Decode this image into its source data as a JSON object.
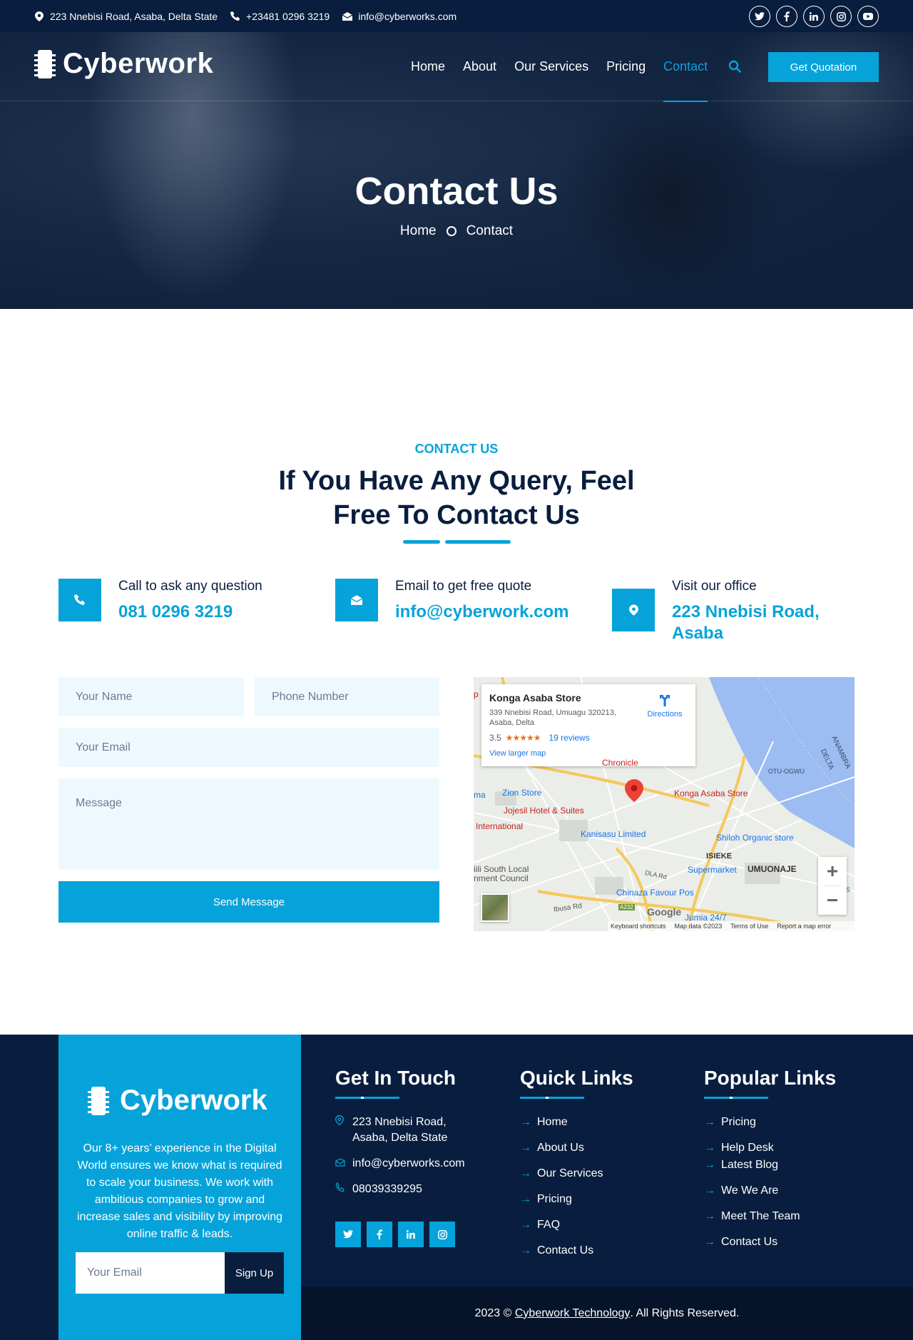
{
  "topbar": {
    "address": "223 Nnebisi Road, Asaba, Delta State",
    "phone": "+23481 0296 3219",
    "email": "info@cyberworks.com",
    "social": [
      "twitter-icon",
      "facebook-icon",
      "linkedin-icon",
      "instagram-icon",
      "youtube-icon"
    ]
  },
  "nav": {
    "brand": "Cyberwork",
    "items": [
      "Home",
      "About",
      "Our Services",
      "Pricing",
      "Contact"
    ],
    "active_item": "Contact",
    "quote_button": "Get Quotation"
  },
  "hero": {
    "title": "Contact Us",
    "breadcrumb": [
      "Home",
      "Contact"
    ]
  },
  "contact": {
    "label": "CONTACT US",
    "title_line1": "If You Have Any Query, Feel",
    "title_line2": "Free To Contact Us",
    "cards": [
      {
        "icon": "phone-icon",
        "label": "Call to ask any question",
        "value": "081 0296 3219"
      },
      {
        "icon": "envelope-icon",
        "label": "Email to get free quote",
        "value": "info@cyberwork.com"
      },
      {
        "icon": "location-pin-icon",
        "label": "Visit our office",
        "value_line1": "223 Nnebisi Road,",
        "value_line2": "Asaba"
      }
    ]
  },
  "form": {
    "name_placeholder": "Your Name",
    "phone_placeholder": "Phone Number",
    "email_placeholder": "Your Email",
    "message_placeholder": "Message",
    "submit_label": "Send Message"
  },
  "map": {
    "place_title": "Konga Asaba Store",
    "place_address": "339 Nnebisi Road, Umuagu 320213, Asaba, Delta",
    "rating": "3.5",
    "stars": "★★★★★",
    "reviews": "19 reviews",
    "view_larger": "View larger map",
    "directions": "Directions",
    "labels": {
      "chronicle": "Chronicle",
      "zion": "Zion Store",
      "ma": "ma",
      "jojesil": "Jojesil Hotel & Suites",
      "international": "International",
      "kanisasu": "Kanisasu Limited",
      "konga": "Konga Asaba Store",
      "shiloh": "Shiloh Organic store",
      "otu_ogwu": "OTU-OGWU",
      "anambra": "ANAMBRA",
      "delta": "DELTA",
      "isieke": "ISIEKE",
      "umuonaje": "UMUONAJE",
      "supermarket": "Supermarket",
      "south_local": "iili South Local",
      "council": "nment Council",
      "dla_rd": "DLA Rd",
      "chinaza": "Chinaza Favour Pos",
      "ibusa": "Ibusa Rd",
      "a232": "A232",
      "jumia": "Jumia 24/7",
      "p": "p",
      "s": "s"
    },
    "google": "Google",
    "footer": [
      "Keyboard shortcuts",
      "Map data ©2023",
      "Terms of Use",
      "Report a map error"
    ],
    "zoom_in": "+",
    "zoom_out": "−"
  },
  "footer": {
    "brand": "Cyberwork",
    "description": "Our 8+ years’ experience in the Digital World ensures we know what is required to scale your business. We work with ambitious companies to grow and increase sales and visibility by improving online traffic & leads.",
    "newsletter_placeholder": "Your Email",
    "newsletter_button": "Sign Up",
    "get_in_touch": {
      "title": "Get In Touch",
      "address_line1": "223 Nnebisi Road,",
      "address_line2": "Asaba, Delta State",
      "email": "info@cyberworks.com",
      "phone": "08039339295"
    },
    "quick_links": {
      "title": "Quick Links",
      "items": [
        "Home",
        "About Us",
        "Our Services",
        "Pricing",
        "FAQ",
        "Contact Us"
      ]
    },
    "popular_links": {
      "title": "Popular Links",
      "items": [
        "Pricing",
        "Help Desk",
        "Latest Blog",
        "We We Are",
        "Meet The Team",
        "Contact Us"
      ]
    },
    "copyright_prefix": "2023 © ",
    "copyright_link": "Cyberwork Technology",
    "copyright_suffix": ". All Rights Reserved."
  }
}
